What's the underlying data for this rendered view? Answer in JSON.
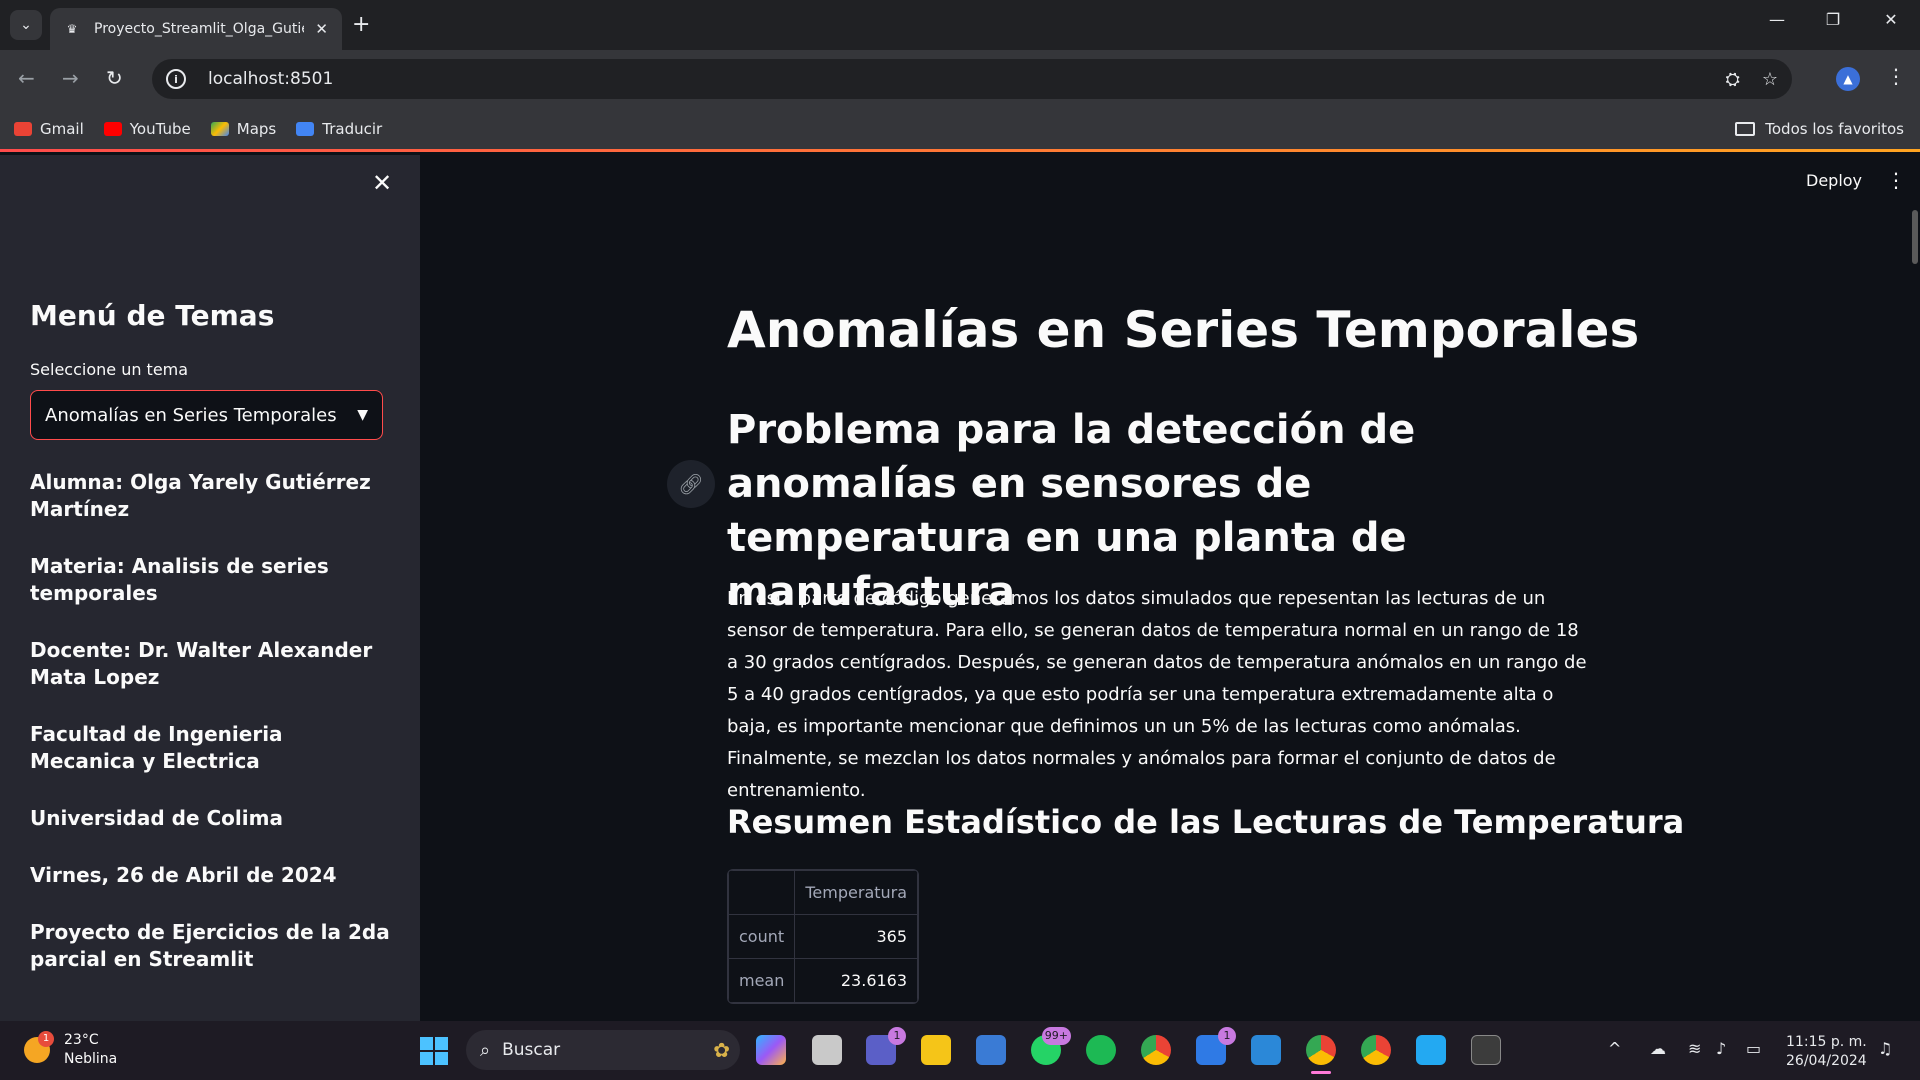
{
  "browser": {
    "tab_title": "Proyecto_Streamlit_Olga_Gutiérrez",
    "url": "localhost:8501",
    "bookmarks": [
      "Gmail",
      "YouTube",
      "Maps",
      "Traducir"
    ],
    "all_bookmarks": "Todos los favoritos"
  },
  "header": {
    "deploy": "Deploy"
  },
  "sidebar": {
    "title": "Menú de Temas",
    "select_label": "Seleccione un tema",
    "select_value": "Anomalías en Series Temporales",
    "items": [
      "Alumna: Olga Yarely Gutiérrez Martínez",
      "Materia: Analisis de series temporales",
      "Docente: Dr. Walter Alexander Mata Lopez",
      "Facultad de Ingenieria Mecanica y Electrica",
      "Universidad de Colima",
      "Virnes, 26 de Abril de 2024",
      "Proyecto de Ejercicios de la 2da parcial en Streamlit"
    ]
  },
  "main": {
    "title": "Anomalías en Series Temporales",
    "subtitle": "Problema para la detección de anomalías en sensores de temperatura en una planta de manufactura",
    "paragraph": "En esta parte de código generamos los datos simulados que repesentan las lecturas de un sensor de temperatura. Para ello, se generan datos de temperatura normal en un rango de 18 a 30 grados centígrados. Después, se generan datos de temperatura anómalos en un rango de 5 a 40 grados centígrados, ya que esto podría ser una temperatura extremadamente alta o baja, es importante mencionar que definimos un un 5% de las lecturas como anómalas. Finalmente, se mezclan los datos normales y anómalos para formar el conjunto de datos de entrenamiento.",
    "section_title": "Resumen Estadístico de las Lecturas de Temperatura",
    "table": {
      "column": "Temperatura",
      "rows": [
        {
          "label": "count",
          "value": "365"
        },
        {
          "label": "mean",
          "value": "23.6163"
        }
      ]
    }
  },
  "taskbar": {
    "weather_temp": "23°C",
    "weather_desc": "Neblina",
    "weather_badge": "1",
    "search": "Buscar",
    "badges": {
      "teams": "1",
      "whatsapp": "99+",
      "todo": "1"
    },
    "time": "11:15 p. m.",
    "date": "26/04/2024"
  },
  "colors": {
    "accent": "#ff4b4b",
    "sidebar_bg": "#262730",
    "main_bg": "#0e1117"
  }
}
